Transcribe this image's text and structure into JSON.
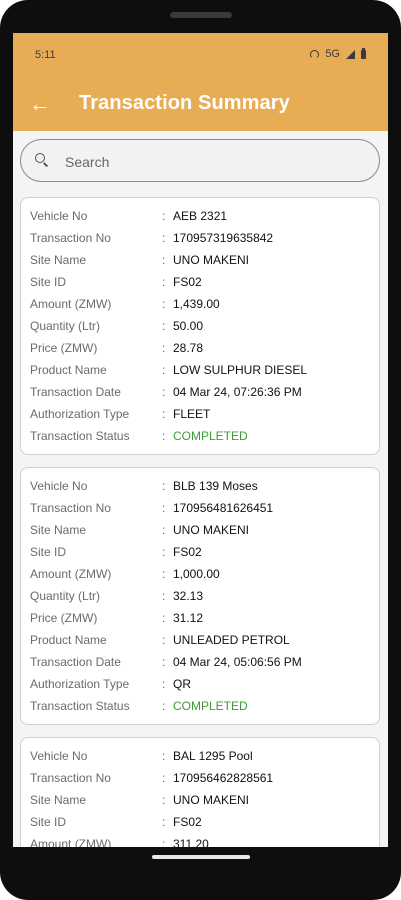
{
  "status_bar": {
    "time": "5:11",
    "network": "5G",
    "icons": [
      "hotspot-icon",
      "signal-icon",
      "battery-icon"
    ]
  },
  "app_bar": {
    "title": "Transaction Summary",
    "back_icon": "arrow-left-icon",
    "color": "#e8ac55"
  },
  "search": {
    "placeholder": "Search",
    "value": ""
  },
  "labels": {
    "vehicle_no": "Vehicle No",
    "transaction_no": "Transaction No",
    "site_name": "Site Name",
    "site_id": "Site ID",
    "amount": "Amount (ZMW)",
    "quantity": "Quantity (Ltr)",
    "price": "Price (ZMW)",
    "product_name": "Product Name",
    "transaction_date": "Transaction Date",
    "authorization_type": "Authorization Type",
    "transaction_status": "Transaction Status",
    "separator": ":"
  },
  "transactions": [
    {
      "vehicle_no": "AEB 2321",
      "transaction_no": "170957319635842",
      "site_name": "UNO MAKENI",
      "site_id": "FS02",
      "amount": "1,439.00",
      "quantity": "50.00",
      "price": "28.78",
      "product_name": "LOW SULPHUR DIESEL",
      "transaction_date": "04 Mar 24, 07:26:36 PM",
      "authorization_type": "FLEET",
      "transaction_status": "COMPLETED"
    },
    {
      "vehicle_no": "BLB 139 Moses",
      "transaction_no": "170956481626451",
      "site_name": "UNO MAKENI",
      "site_id": "FS02",
      "amount": "1,000.00",
      "quantity": "32.13",
      "price": "31.12",
      "product_name": "UNLEADED PETROL",
      "transaction_date": "04 Mar 24, 05:06:56 PM",
      "authorization_type": "QR",
      "transaction_status": "COMPLETED"
    },
    {
      "vehicle_no": "BAL 1295 Pool",
      "transaction_no": "170956462828561",
      "site_name": "UNO MAKENI",
      "site_id": "FS02",
      "amount": "311.20"
    }
  ],
  "colors": {
    "completed": "#3f9a3a"
  }
}
